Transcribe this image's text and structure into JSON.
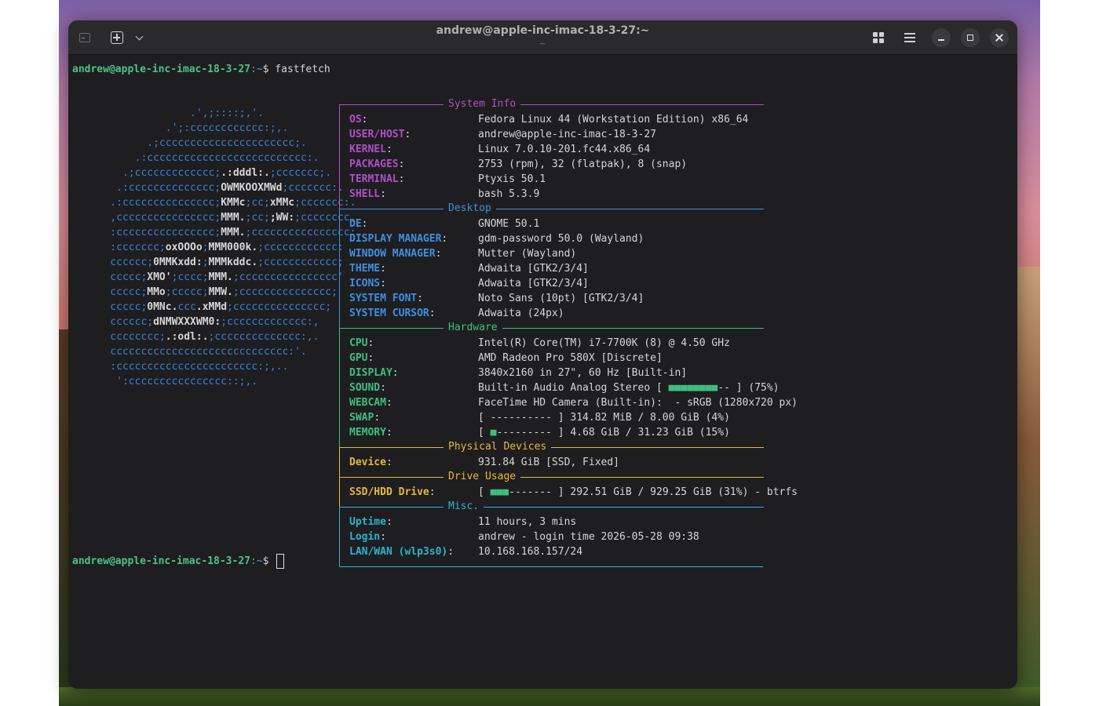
{
  "window": {
    "title": "andrew@apple-inc-imac-18-3-27:~",
    "subtitle": "~"
  },
  "prompt": {
    "user_host": "andrew@apple-inc-imac-18-3-27",
    "separator": ":",
    "path": "~",
    "symbol": "$ ",
    "command": "fastfetch"
  },
  "ascii_logo": [
    [
      "                 .',;::::;,'.",
      ""
    ],
    [
      "             .';:cccccccccccc:;,.",
      ""
    ],
    [
      "          .;cccccccccccccccccccccc;.",
      ""
    ],
    [
      "        .:cccccccccccccccccccccccccc:.",
      ""
    ],
    [
      "      .;ccccccccccccc;",
      ".:dddl:.",
      ";ccccccc;."
    ],
    [
      "     .:cccccccccccccc;",
      "OWMKOOXMWd",
      ";ccccccc:."
    ],
    [
      "    .:ccccccccccccccc;",
      "KMMc",
      ";cc;",
      "xMMc",
      ";ccccccc:."
    ],
    [
      "    ,cccccccccccccccc;",
      "MMM.",
      ";cc;",
      ";WW:",
      ";cccccccc,"
    ],
    [
      "    :cccccccccccccccc;",
      "MMM.",
      ";cccccccccccccccc:"
    ],
    [
      "    :ccccccc;",
      "oxOOOo",
      ";",
      "MMM000k.",
      ";cccccccccccc:"
    ],
    [
      "    cccccc;",
      "0MMKxdd:",
      ";",
      "MMMkddc.",
      ";cccccccccccc;"
    ],
    [
      "    ccccc;",
      "XMO'",
      ";cccc;",
      "MMM.",
      ";cccccccccccccccc'"
    ],
    [
      "    ccccc;",
      "MMo",
      ";ccccc;",
      "MMW.",
      ";ccccccccccccccc;"
    ],
    [
      "    ccccc;",
      "0MNc.",
      "ccc",
      ".xMMd",
      ";ccccccccccccccc;"
    ],
    [
      "    cccccc;",
      "dNMWXXXWM0:",
      ";ccccccccccccc:,"
    ],
    [
      "    cccccccc;",
      ".:odl:.",
      ";cccccccccccccc:,."
    ],
    [
      "    ccccccccccccccccccccccccccccc:'.",
      ""
    ],
    [
      "    :ccccccccccccccccccccccc:;,..",
      ""
    ],
    [
      "     ':cccccccccccccccc::;,.",
      ""
    ]
  ],
  "sections": [
    {
      "title": "System Info",
      "color": "#b04fc9",
      "rows": [
        {
          "key": "OS",
          "value": "Fedora Linux 44 (Workstation Edition) x86_64"
        },
        {
          "key": "USER/HOST",
          "value": "andrew@apple-inc-imac-18-3-27"
        },
        {
          "key": "KERNEL",
          "value": "Linux 7.0.10-201.fc44.x86_64"
        },
        {
          "key": "PACKAGES",
          "value": "2753 (rpm), 32 (flatpak), 8 (snap)"
        },
        {
          "key": "TERMINAL",
          "value": "Ptyxis 50.1"
        },
        {
          "key": "SHELL",
          "value": "bash 5.3.9"
        }
      ]
    },
    {
      "title": "Desktop",
      "color": "#3f8fe0",
      "rows": [
        {
          "key": "DE",
          "value": "GNOME 50.1"
        },
        {
          "key": "DISPLAY MANAGER",
          "value": "gdm-password 50.0 (Wayland)"
        },
        {
          "key": "WINDOW MANAGER",
          "value": "Mutter (Wayland)"
        },
        {
          "key": "THEME",
          "value": "Adwaita [GTK2/3/4]"
        },
        {
          "key": "ICONS",
          "value": "Adwaita [GTK2/3/4]"
        },
        {
          "key": "SYSTEM FONT",
          "value": "Noto Sans (10pt) [GTK2/3/4]"
        },
        {
          "key": "SYSTEM CURSOR",
          "value": "Adwaita (24px)"
        }
      ]
    },
    {
      "title": "Hardware",
      "color": "#3fbf7f",
      "rows": [
        {
          "key": "CPU",
          "value": "Intel(R) Core(TM) i7-7700K (8) @ 4.50 GHz"
        },
        {
          "key": "GPU",
          "value": "AMD Radeon Pro 580X [Discrete]"
        },
        {
          "key": "DISPLAY",
          "value": "3840x2160 in 27\", 60 Hz [Built-in]"
        },
        {
          "key": "SOUND",
          "value_pre": "Built-in Audio Analog Stereo [ ",
          "bar_fill": "■■■■■■■■",
          "bar_empty": "-- ",
          "value_post": "] (75%)"
        },
        {
          "key": "WEBCAM",
          "value": "FaceTime HD Camera (Built-in):  - sRGB (1280x720 px)"
        },
        {
          "key": "SWAP",
          "value_pre": "[ ",
          "bar_fill": "",
          "bar_empty": "---------- ",
          "value_post": "] 314.82 MiB / 8.00 GiB (4%)"
        },
        {
          "key": "MEMORY",
          "value_pre": "[ ",
          "bar_fill": "■",
          "bar_empty": "--------- ",
          "value_post": "] 4.68 GiB / 31.23 GiB (15%)"
        }
      ]
    },
    {
      "title": "Physical Devices",
      "color": "#e5b93a",
      "rows": [
        {
          "key": "Device",
          "value": "931.84 GiB [SSD, Fixed]"
        }
      ]
    },
    {
      "title": "Drive Usage",
      "color": "#e5b93a",
      "rows": [
        {
          "key": "SSD/HDD Drive",
          "value_pre": "[ ",
          "bar_fill": "■■■",
          "bar_empty": "------- ",
          "value_post": "] 292.51 GiB / 929.25 GiB (31%) - btrfs"
        }
      ]
    },
    {
      "title": "Misc.",
      "color": "#2fb3d0",
      "rows": [
        {
          "key": "Uptime",
          "value": "11 hours, 3 mins"
        },
        {
          "key": "Login",
          "value": "andrew - login time 2026-05-28 09:38"
        },
        {
          "key": "LAN/WAN (wlp3s0)",
          "value": "10.168.168.157/24"
        }
      ]
    }
  ],
  "colors": {
    "bar_fill": "#3fbf7f",
    "prompt_user": "#4ec18a",
    "prompt_path": "#4a9ae0",
    "terminal_bg": "#1e1e20",
    "headerbar_bg": "#2a2a2c"
  },
  "icons": {
    "terminal": "terminal-icon",
    "new_tab": "new-tab-icon",
    "tab_menu": "chevron-down-icon",
    "grid": "grid-icon",
    "menu": "hamburger-icon",
    "minimize": "minimize-icon",
    "maximize": "maximize-icon",
    "close": "close-icon"
  }
}
